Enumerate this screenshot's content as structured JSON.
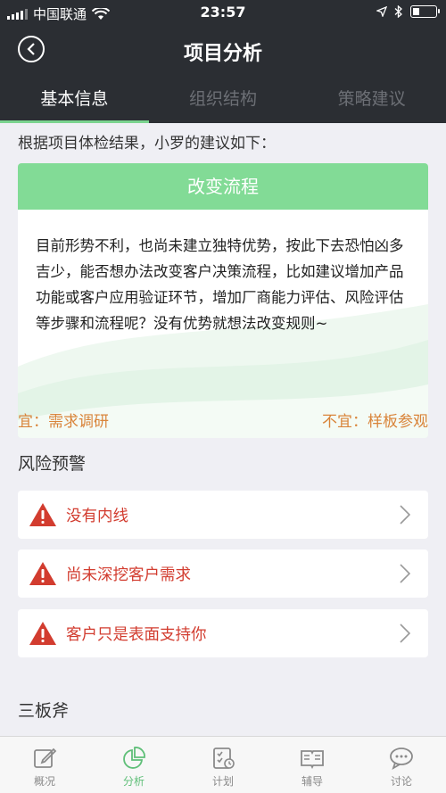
{
  "status_bar": {
    "carrier": "中国联通",
    "time": "23:57"
  },
  "nav": {
    "title": "项目分析",
    "back_icon": "back-arrow-icon"
  },
  "tabs": [
    {
      "label": "基本信息",
      "active": true
    },
    {
      "label": "组织结构",
      "active": false
    },
    {
      "label": "策略建议",
      "active": false
    }
  ],
  "intro": "根据项目体检结果，小罗的建议如下：",
  "card": {
    "title": "改变流程",
    "body": "目前形势不利，也尚未建立独特优势，按此下去恐怕凶多吉少，能否想办法改变客户决策流程，比如建议增加产品功能或客户应用验证环节，增加厂商能力评估、风险评估等步骤和流程呢？没有优势就想法改变规则~",
    "good": "宜：需求调研",
    "bad": "不宜：样板参观"
  },
  "risk_section_title": "风险预警",
  "risks": [
    {
      "label": "没有内线"
    },
    {
      "label": "尚未深挖客户需求"
    },
    {
      "label": "客户只是表面支持你"
    }
  ],
  "next_section_title": "三板斧",
  "tabbar": [
    {
      "label": "概况",
      "icon": "edit-icon",
      "active": false
    },
    {
      "label": "分析",
      "icon": "pie-chart-icon",
      "active": true
    },
    {
      "label": "计划",
      "icon": "checklist-icon",
      "active": false
    },
    {
      "label": "辅导",
      "icon": "book-icon",
      "active": false
    },
    {
      "label": "讨论",
      "icon": "chat-bubble-icon",
      "active": false
    }
  ],
  "colors": {
    "nav_bg": "#2b2e33",
    "accent_green": "#82db96",
    "warning_red": "#d23c2f",
    "footer_orange": "#d9843a"
  }
}
